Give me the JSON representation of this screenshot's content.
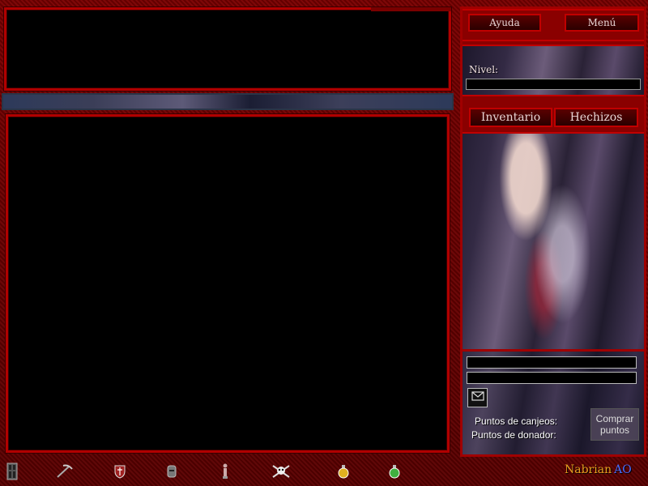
{
  "header": {
    "help_label": "Ayuda",
    "menu_label": "Menú"
  },
  "stats": {
    "level_label": "Nivel:"
  },
  "tabs": {
    "inventory_label": "Inventario",
    "spells_label": "Hechizos"
  },
  "points": {
    "exchange_label": "Puntos de canjeos:",
    "donor_label": "Puntos de donador:",
    "buy_label": "Comprar puntos"
  },
  "brand": {
    "name": "Nabrian",
    "suffix": "AO"
  },
  "toolbar": {
    "icons": [
      "door-icon",
      "pickaxe-icon",
      "red-shield-icon",
      "helmet-icon",
      "statue-icon",
      "skull-crossbones-icon",
      "yellow-potion-icon",
      "green-potion-icon"
    ]
  },
  "colors": {
    "frame_red": "#b00000",
    "background": "#5a0000",
    "brand_gold": "#e8a020",
    "brand_blue": "#4a6cff"
  }
}
